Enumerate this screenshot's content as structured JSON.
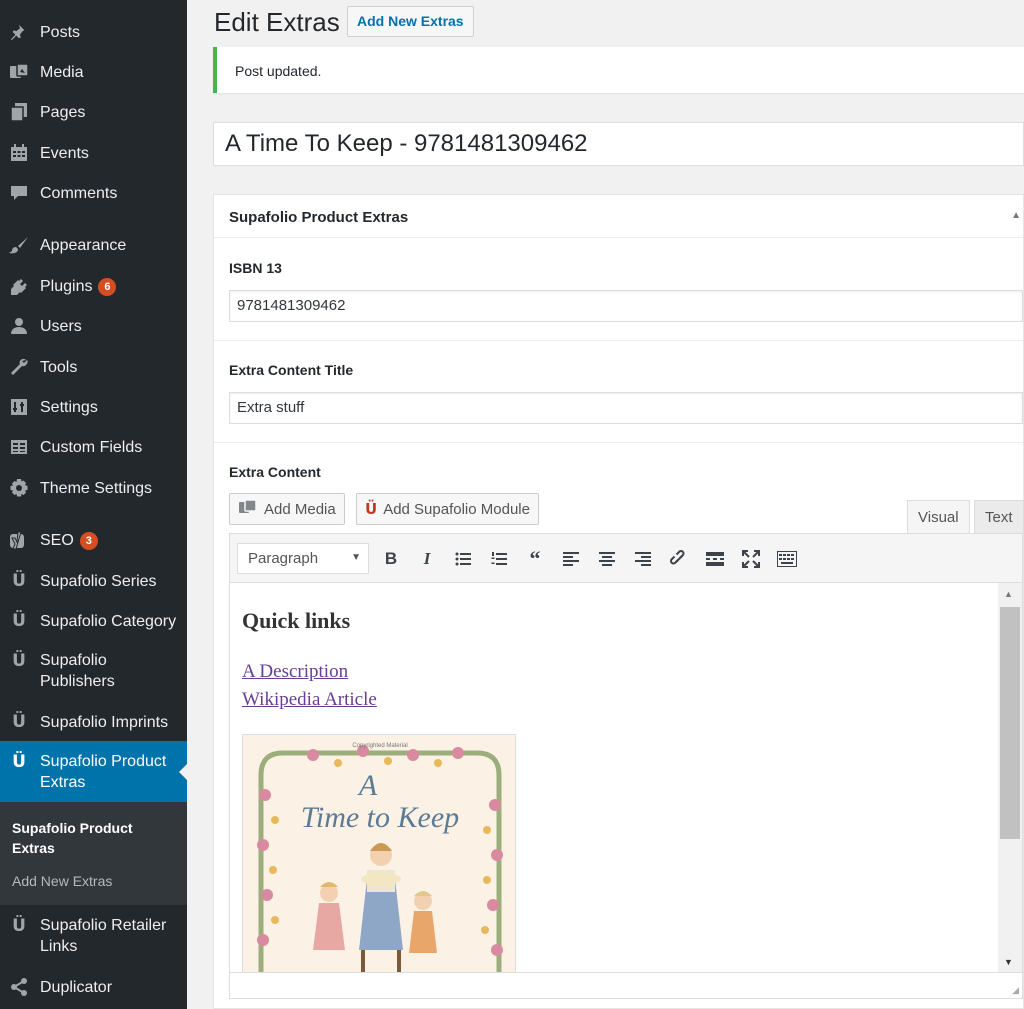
{
  "sidebar": {
    "items": [
      {
        "label": "Posts",
        "icon": "pushpin-icon"
      },
      {
        "label": "Media",
        "icon": "media-icon"
      },
      {
        "label": "Pages",
        "icon": "pages-icon"
      },
      {
        "label": "Events",
        "icon": "calendar-icon"
      },
      {
        "label": "Comments",
        "icon": "comment-icon"
      },
      {
        "label": "Appearance",
        "icon": "paintbrush-icon"
      },
      {
        "label": "Plugins",
        "icon": "plugin-icon",
        "badge": "6"
      },
      {
        "label": "Users",
        "icon": "user-icon"
      },
      {
        "label": "Tools",
        "icon": "wrench-icon"
      },
      {
        "label": "Settings",
        "icon": "settings-icon"
      },
      {
        "label": "Custom Fields",
        "icon": "table-icon"
      },
      {
        "label": "Theme Settings",
        "icon": "gear-icon"
      },
      {
        "label": "SEO",
        "icon": "yoast-icon",
        "badge": "3"
      },
      {
        "label": "Supafolio Series",
        "icon": "supafolio-icon"
      },
      {
        "label": "Supafolio Category",
        "icon": "supafolio-icon"
      },
      {
        "label": "Supafolio Publishers",
        "icon": "supafolio-icon"
      },
      {
        "label": "Supafolio Imprints",
        "icon": "supafolio-icon"
      },
      {
        "label": "Supafolio Product Extras",
        "icon": "supafolio-icon"
      },
      {
        "label": "Supafolio Retailer Links",
        "icon": "supafolio-icon"
      },
      {
        "label": "Duplicator",
        "icon": "share-icon"
      }
    ],
    "submenu": {
      "current": "Supafolio Product Extras",
      "add_new": "Add New Extras"
    },
    "colors": {
      "background": "#23282d",
      "active": "#0073aa",
      "badge": "#d54e21"
    }
  },
  "header": {
    "title": "Edit Extras",
    "add_new_label": "Add New Extras"
  },
  "notice": {
    "text": "Post updated.",
    "color": "#46b450"
  },
  "post_title": "A Time To Keep - 9781481309462",
  "metabox": {
    "title": "Supafolio Product Extras",
    "isbn_label": "ISBN 13",
    "isbn_value": "9781481309462",
    "extra_title_label": "Extra Content Title",
    "extra_title_value": "Extra stuff",
    "extra_content_label": "Extra Content"
  },
  "editor": {
    "add_media_label": "Add Media",
    "add_module_label": "Add Supafolio Module",
    "tab_visual": "Visual",
    "tab_text": "Text",
    "format_value": "Paragraph",
    "toolbar_icons": [
      "bold-icon",
      "italic-icon",
      "bullet-list-icon",
      "numbered-list-icon",
      "blockquote-icon",
      "align-left-icon",
      "align-center-icon",
      "align-right-icon",
      "link-icon",
      "read-more-icon",
      "fullscreen-icon",
      "toolbar-toggle-icon"
    ],
    "content": {
      "heading": "Quick links",
      "links": [
        "A Description",
        "Wikipedia Article"
      ],
      "image_caption_small": "Copyrighted Material",
      "image_title_line1": "A",
      "image_title_line2": "Time to Keep"
    }
  }
}
